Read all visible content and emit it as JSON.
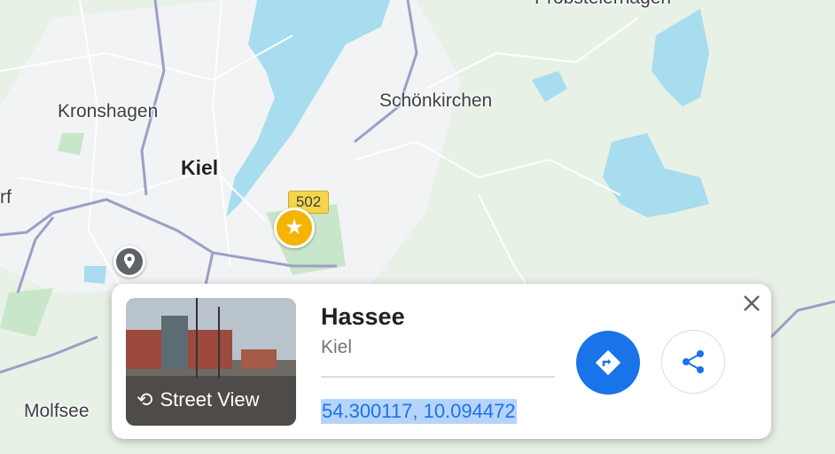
{
  "map": {
    "places": [
      {
        "id": "probsteierhagen",
        "label": "Probsteierhagen"
      },
      {
        "id": "schonkirchen",
        "label": "Schönkirchen"
      },
      {
        "id": "kronshagen",
        "label": "Kronshagen"
      },
      {
        "id": "kiel",
        "label": "Kiel"
      },
      {
        "id": "rf",
        "label": "rf"
      },
      {
        "id": "molfsee",
        "label": "Molfsee"
      }
    ],
    "road_badge": "502",
    "colors": {
      "water": "#a8dcef",
      "park": "#c8e6c9",
      "land": "#e8f1e6",
      "urban": "#f1f3f4",
      "road": "#ffffff",
      "major_road": "#9aa0c6",
      "badge": "#f7d54a",
      "star_pin": "#f4b400"
    }
  },
  "card": {
    "title": "Hassee",
    "subtitle": "Kiel",
    "coordinates": "54.300117, 10.094472",
    "street_view_label": "Street View",
    "icons": {
      "close": "close-icon",
      "directions": "directions-icon",
      "share": "share-icon",
      "street_view": "street-view-icon"
    },
    "colors": {
      "accent": "#1a73e8",
      "selection": "#b6d4fb"
    }
  }
}
